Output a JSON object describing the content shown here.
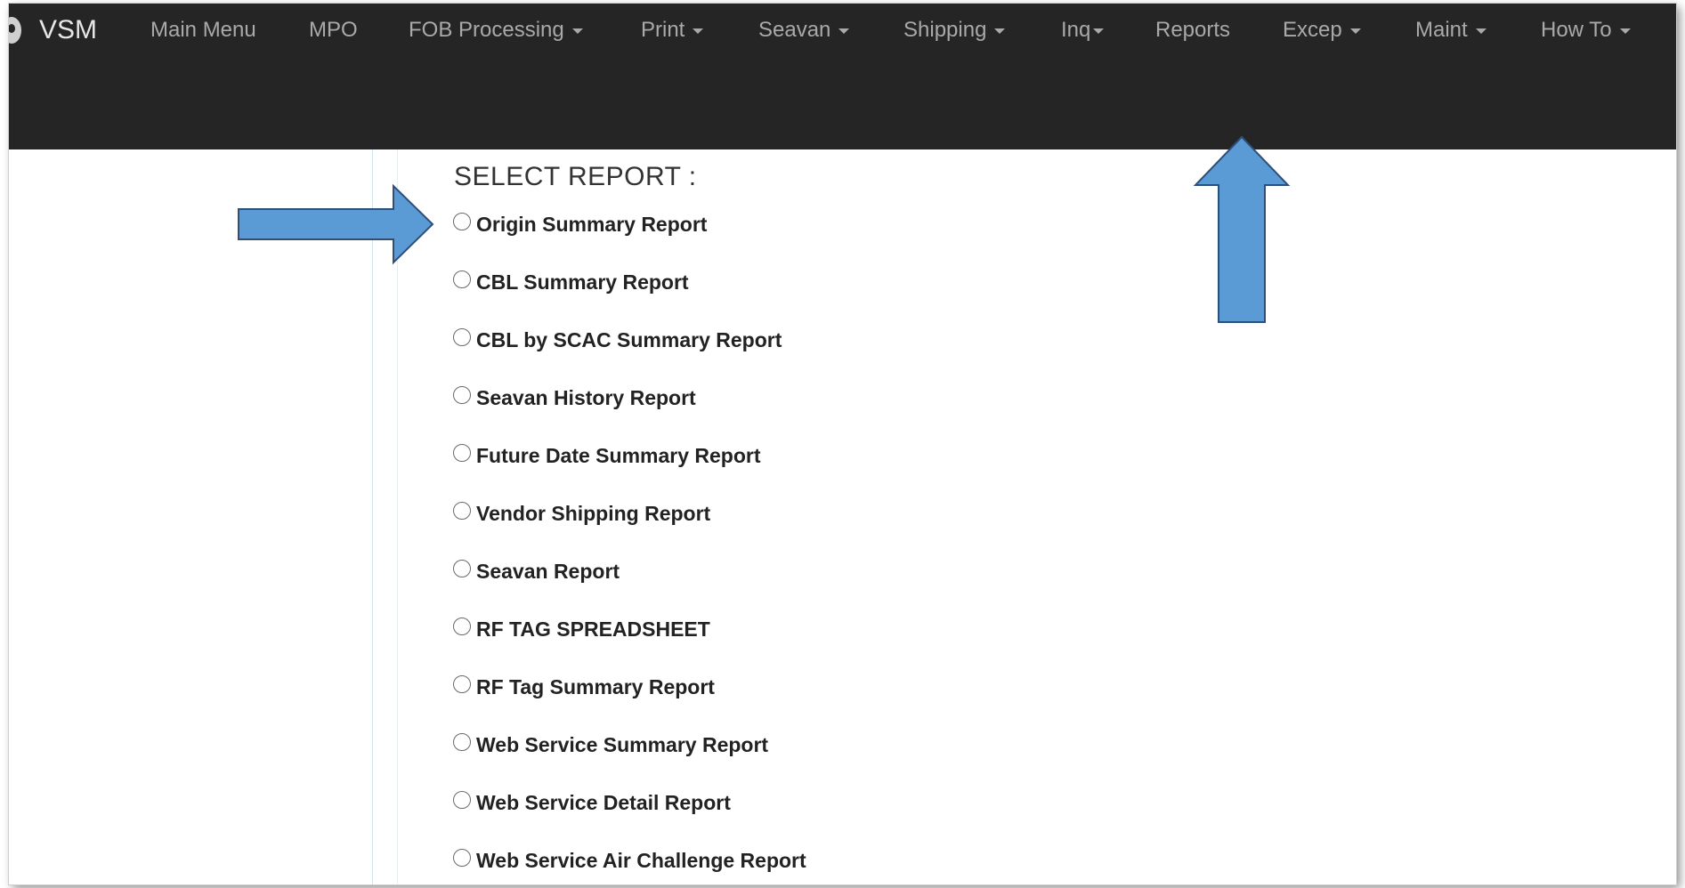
{
  "navbar": {
    "brand": "VSM",
    "items": [
      {
        "label": "Main Menu",
        "dropdown": false
      },
      {
        "label": "MPO",
        "dropdown": false
      },
      {
        "label": "FOB Processing",
        "dropdown": true
      },
      {
        "label": "Print",
        "dropdown": true
      },
      {
        "label": "Seavan",
        "dropdown": true
      },
      {
        "label": "Shipping",
        "dropdown": true
      },
      {
        "label": "Inq",
        "dropdown": true
      },
      {
        "label": "Reports",
        "dropdown": false
      },
      {
        "label": "Excep",
        "dropdown": true
      },
      {
        "label": "Maint",
        "dropdown": true
      },
      {
        "label": "How To",
        "dropdown": true
      }
    ]
  },
  "main": {
    "title": "SELECT REPORT :",
    "reports": [
      {
        "label": "Origin Summary Report",
        "selected": false
      },
      {
        "label": "CBL Summary Report",
        "selected": false
      },
      {
        "label": "CBL by SCAC Summary Report",
        "selected": false
      },
      {
        "label": "Seavan History Report",
        "selected": false
      },
      {
        "label": "Future Date Summary Report",
        "selected": false
      },
      {
        "label": "Vendor Shipping Report",
        "selected": false
      },
      {
        "label": "Seavan Report",
        "selected": false
      },
      {
        "label": "RF TAG SPREADSHEET",
        "selected": false
      },
      {
        "label": "RF Tag Summary Report",
        "selected": false
      },
      {
        "label": "Web Service Summary Report",
        "selected": false
      },
      {
        "label": "Web Service Detail Report",
        "selected": false
      },
      {
        "label": "Web Service Air Challenge Report",
        "selected": false
      }
    ]
  },
  "colors": {
    "navbar_bg": "#252525",
    "nav_text": "#a9a9a9",
    "annotation_arrow": "#5b9bd5",
    "annotation_arrow_border": "#2e4f7a"
  },
  "annotations": [
    {
      "type": "arrow",
      "direction": "right",
      "points_to": "Origin Summary Report"
    },
    {
      "type": "arrow",
      "direction": "up",
      "points_to": "Reports"
    }
  ]
}
